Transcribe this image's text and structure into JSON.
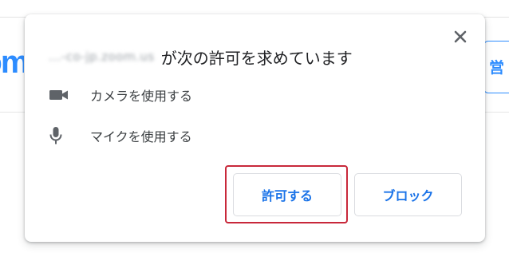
{
  "background": {
    "logo_fragment": "zoom",
    "side_button_fragment": "営"
  },
  "dialog": {
    "origin_text": "...-co-jp.zoom.us",
    "title_suffix": "が次の許可を求めています",
    "close_label": "×",
    "permissions": [
      {
        "icon": "camera-icon",
        "label": "カメラを使用する"
      },
      {
        "icon": "microphone-icon",
        "label": "マイクを使用する"
      }
    ],
    "allow_label": "許可する",
    "block_label": "ブロック"
  },
  "colors": {
    "accent": "#1a73e8",
    "highlight": "#c8283a",
    "zoom_blue": "#2d8cff"
  }
}
